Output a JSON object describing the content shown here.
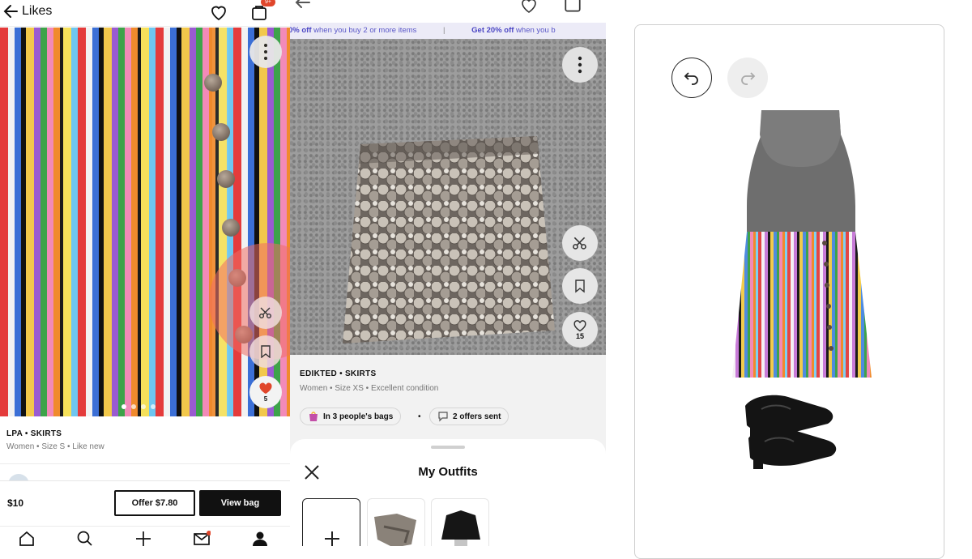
{
  "panel_likes": {
    "header": {
      "back_icon": "arrow-left-icon",
      "title": "Likes",
      "cart_badge": "9+"
    },
    "listing": {
      "brand_category": "LPA • SKIRTS",
      "meta": "Women • Size S • Like new",
      "like_count": "5"
    },
    "footer": {
      "price": "$10",
      "offer_label": "Offer $7.80",
      "view_bag_label": "View bag"
    },
    "nav_icons": [
      "home-icon",
      "search-icon",
      "plus-icon",
      "inbox-icon",
      "profile-icon"
    ]
  },
  "panel_listing": {
    "promo": [
      {
        "bold": "0% off",
        "text": " when you buy 2 or more items"
      },
      {
        "bold": "Get 20% off",
        "text": " when you b"
      }
    ],
    "listing": {
      "brand_category": "EDIKTED • SKIRTS",
      "meta": "Women • Size XS • Excellent condition",
      "like_count": "15"
    },
    "chips": [
      "In 3 people's bags",
      "2 offers sent"
    ],
    "sheet": {
      "title": "My Outfits"
    }
  },
  "panel_editor": {
    "icons": [
      "undo-icon",
      "redo-icon"
    ]
  },
  "colors": {
    "accent_red": "#e0462b",
    "promo_bg": "#ecebf7",
    "promo_text": "#4b46c4",
    "tap_highlight": "#f06e64"
  }
}
